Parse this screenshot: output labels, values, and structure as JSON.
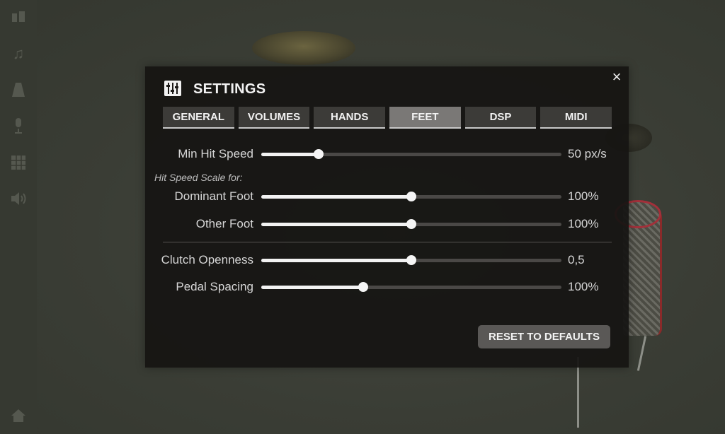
{
  "sidebar": {
    "items": [
      {
        "icon": "drum-kit-icon"
      },
      {
        "icon": "music-note-icon"
      },
      {
        "icon": "metronome-icon"
      },
      {
        "icon": "microphone-icon"
      },
      {
        "icon": "grid-icon"
      },
      {
        "icon": "speaker-icon"
      },
      {
        "icon": "home-icon"
      }
    ]
  },
  "modal": {
    "title": "SETTINGS",
    "close_label": "×",
    "tabs": [
      {
        "label": "GENERAL",
        "active": false
      },
      {
        "label": "VOLUMES",
        "active": false
      },
      {
        "label": "HANDS",
        "active": false
      },
      {
        "label": "FEET",
        "active": true
      },
      {
        "label": "DSP",
        "active": false
      },
      {
        "label": "MIDI",
        "active": false
      }
    ],
    "section_label": "Hit Speed Scale for:",
    "sliders": [
      {
        "label": "Min Hit Speed",
        "value": "50 px/s",
        "level": 0.19
      },
      {
        "label": "Dominant Foot",
        "value": "100%",
        "level": 0.5
      },
      {
        "label": "Other Foot",
        "value": "100%",
        "level": 0.5
      },
      {
        "label": "Clutch Openness",
        "value": "0,5",
        "level": 0.5
      },
      {
        "label": "Pedal Spacing",
        "value": "100%",
        "level": 0.34
      }
    ],
    "reset_label": "RESET TO DEFAULTS"
  },
  "colors": {
    "accent": "#f2f2f2",
    "tab_active": "#7a7876",
    "tab_inactive": "#3c3b38",
    "track": "#4a4846",
    "button": "#5a5856"
  }
}
